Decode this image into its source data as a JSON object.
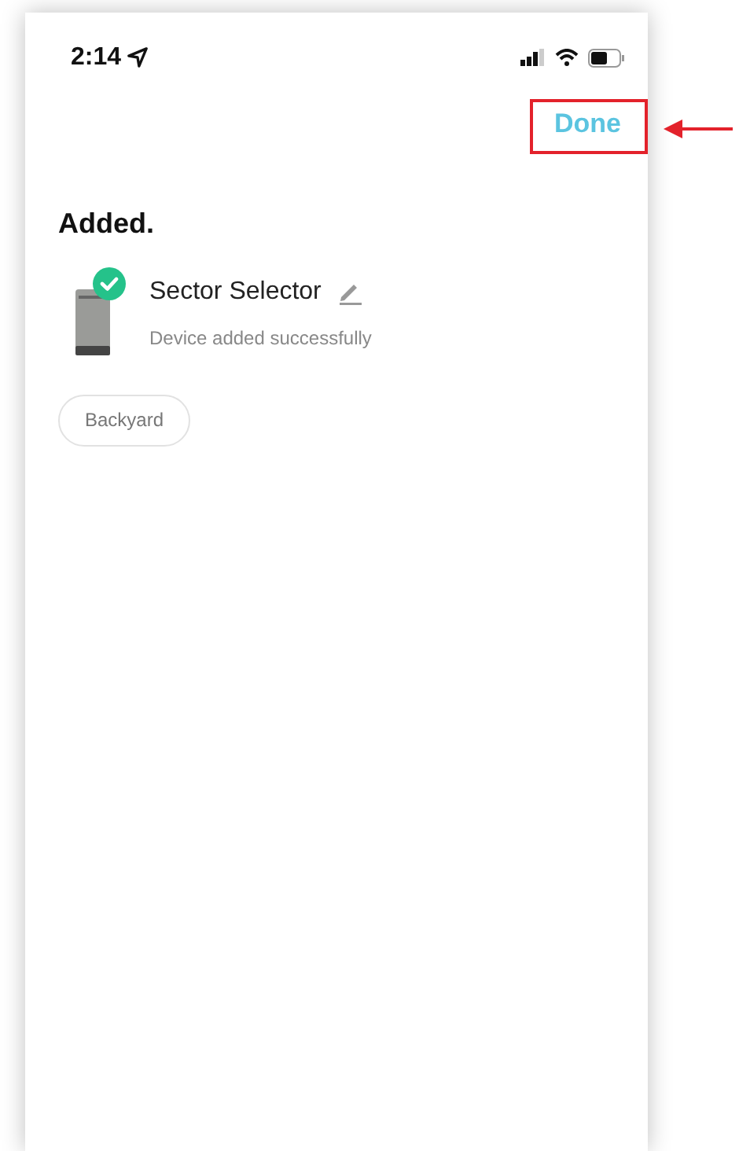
{
  "status_bar": {
    "time": "2:14"
  },
  "nav": {
    "done_button": "Done"
  },
  "heading": "Added.",
  "device": {
    "name": "Sector Selector",
    "status": "Device added successfully",
    "added": true
  },
  "room_tags": [
    {
      "label": "Backyard"
    }
  ]
}
